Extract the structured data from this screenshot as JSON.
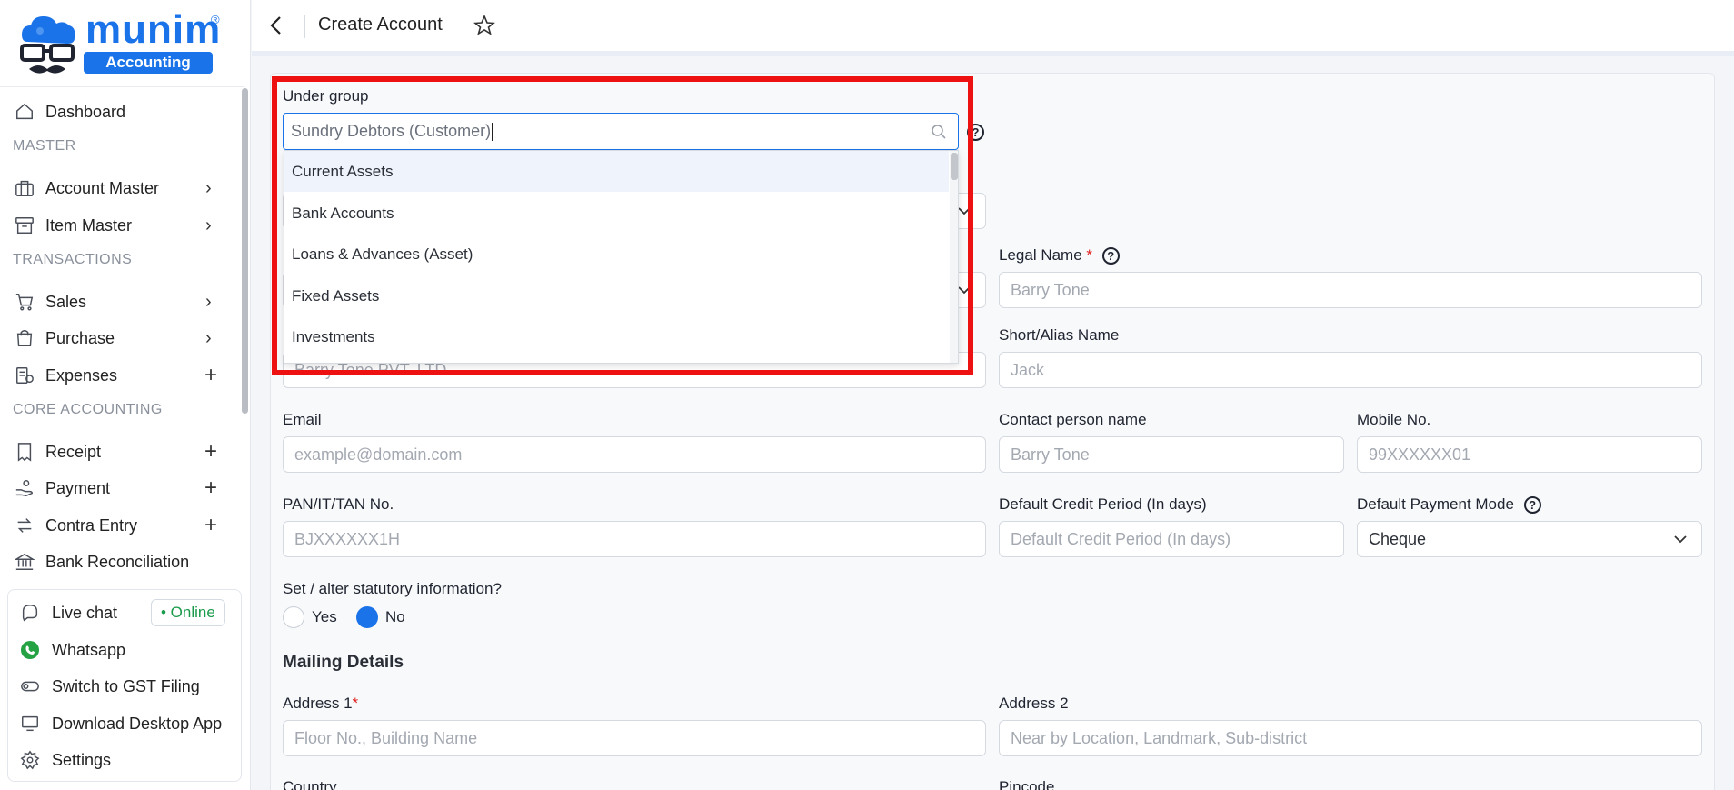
{
  "brand": {
    "name": "munim",
    "registered": "®",
    "tagline": "Accounting"
  },
  "sidebar": {
    "items": [
      {
        "label": "Dashboard",
        "icon": "home-icon"
      },
      {
        "label": "Account Master",
        "icon": "briefcase-icon"
      },
      {
        "label": "Item Master",
        "icon": "archive-icon"
      },
      {
        "label": "Sales",
        "icon": "cart-icon"
      },
      {
        "label": "Purchase",
        "icon": "bag-icon"
      },
      {
        "label": "Expenses",
        "icon": "expenses-icon"
      },
      {
        "label": "Receipt",
        "icon": "receipt-icon"
      },
      {
        "label": "Payment",
        "icon": "payment-icon"
      },
      {
        "label": "Contra Entry",
        "icon": "contra-icon"
      },
      {
        "label": "Bank Reconciliation",
        "icon": "bank-icon"
      }
    ],
    "sections": {
      "master": "MASTER",
      "transactions": "TRANSACTIONS",
      "core": "CORE ACCOUNTING"
    },
    "bottom": {
      "live_chat": "Live chat",
      "online": "• Online",
      "whatsapp": "Whatsapp",
      "gst": "Switch to GST Filing",
      "desktop": "Download Desktop App",
      "settings": "Settings"
    }
  },
  "header": {
    "title": "Create Account"
  },
  "form": {
    "under_group_label": "Under group",
    "under_group_value": "Sundry Debtors (Customer)",
    "under_group_options": [
      "Current Assets",
      "Bank Accounts",
      "Loans & Advances (Asset)",
      "Fixed Assets",
      "Investments"
    ],
    "legal_name_label": "Legal Name",
    "legal_name_placeholder": "Barry Tone",
    "alias_label": "Short/Alias Name",
    "alias_placeholder": "Jack",
    "hidden_name_placeholder": "Barry Tone PVT. LTD.",
    "email_label": "Email",
    "email_placeholder": "example@domain.com",
    "contact_label": "Contact person name",
    "contact_placeholder": "Barry Tone",
    "mobile_label": "Mobile No.",
    "mobile_placeholder": "99XXXXXX01",
    "pan_label": "PAN/IT/TAN No.",
    "pan_placeholder": "BJXXXXXX1H",
    "credit_label": "Default Credit Period (In days)",
    "credit_placeholder": "Default Credit Period (In days)",
    "payment_mode_label": "Default Payment Mode",
    "payment_mode_value": "Cheque",
    "statutory_label": "Set / alter statutory information?",
    "yes_label": "Yes",
    "no_label": "No",
    "statutory_selected": "No",
    "mailing_title": "Mailing Details",
    "address1_label": "Address 1",
    "address1_placeholder": "Floor No., Building Name",
    "address2_label": "Address 2",
    "address2_placeholder": "Near by Location, Landmark, Sub-district",
    "country_label": "Country",
    "pincode_label": "Pincode"
  },
  "colors": {
    "accent": "#1a73e8",
    "highlight": "#ee1111",
    "online": "#1a9a4b",
    "required": "#e02020"
  }
}
